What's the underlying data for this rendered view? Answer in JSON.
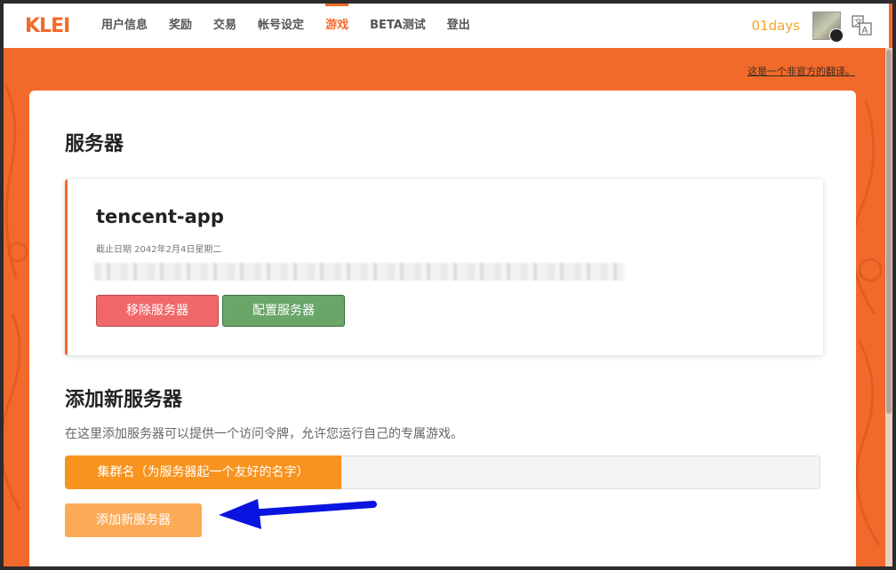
{
  "brand": {
    "logo_text": "KLEI",
    "accent": "#f26a2b"
  },
  "nav": {
    "items": [
      {
        "label": "用户信息"
      },
      {
        "label": "奖励"
      },
      {
        "label": "交易"
      },
      {
        "label": "帐号设定"
      },
      {
        "label": "游戏",
        "active": true
      },
      {
        "label": "BETA测试"
      },
      {
        "label": "登出"
      }
    ]
  },
  "user": {
    "name": "01days"
  },
  "translation_note": "这是一个非官方的翻译。",
  "page": {
    "title": "服务器"
  },
  "server": {
    "name": "tencent-app",
    "expiry": "截止日期 2042年2月4日星期二",
    "remove_label": "移除服务器",
    "configure_label": "配置服务器"
  },
  "add_server": {
    "title": "添加新服务器",
    "description": "在这里添加服务器可以提供一个访问令牌，允许您运行自己的专属游戏。",
    "cluster_label": "集群名（为服务器起一个友好的名字）",
    "cluster_value": "",
    "button_label": "添加新服务器"
  }
}
